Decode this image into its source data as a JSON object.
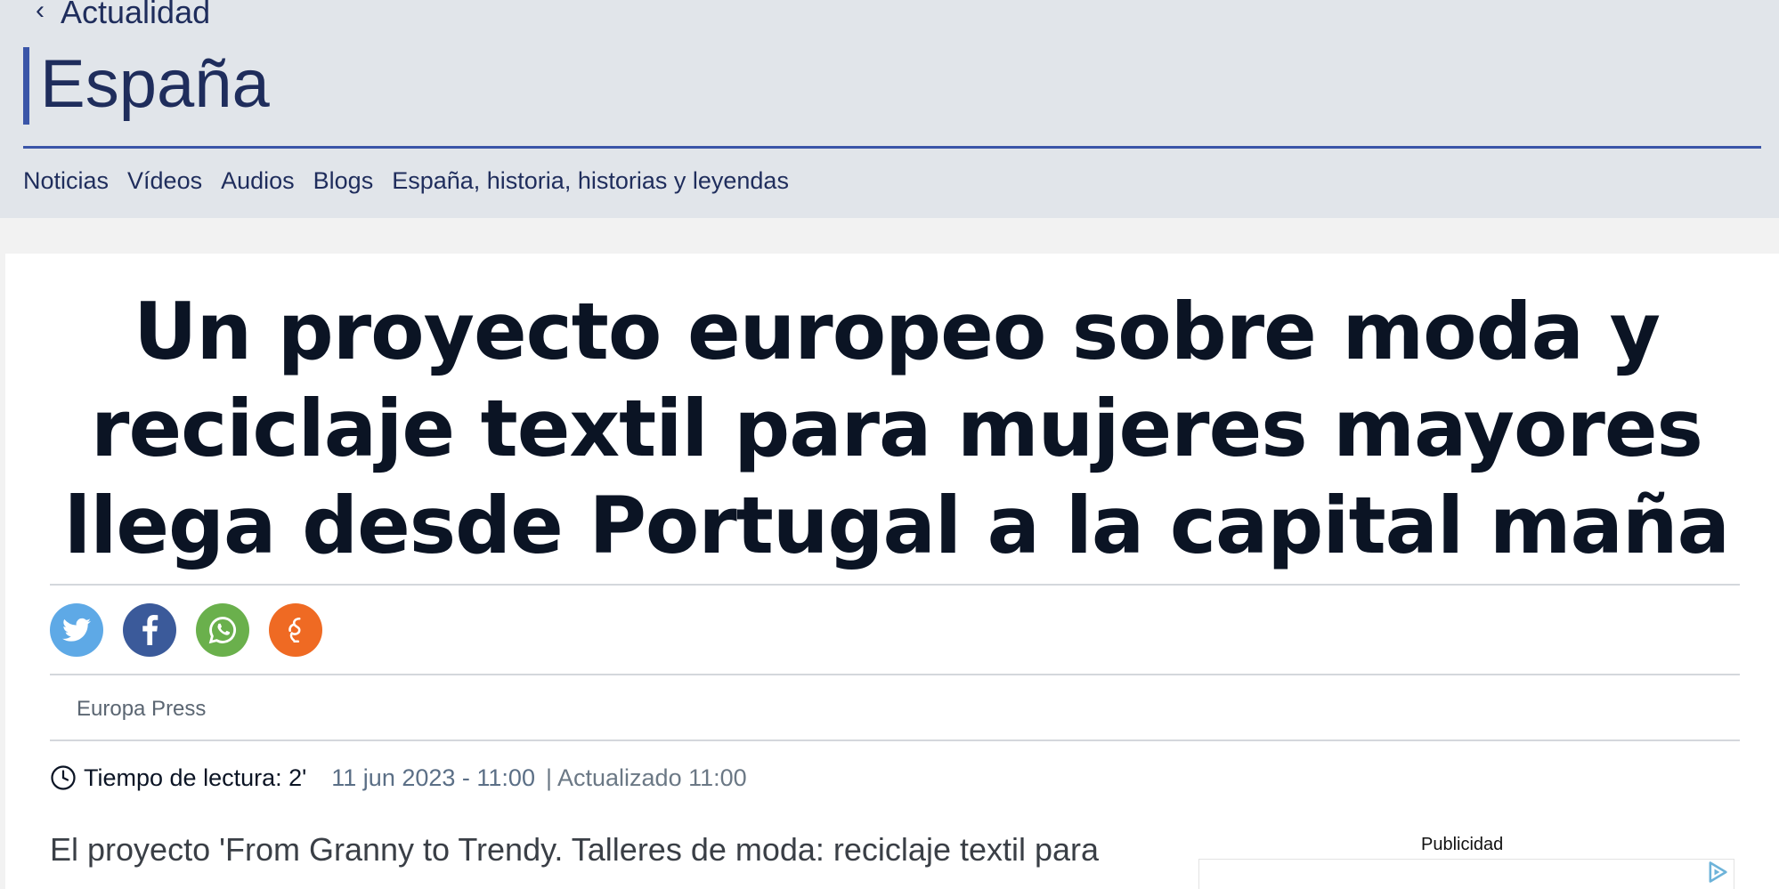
{
  "header": {
    "back_label": "Actualidad",
    "section_title": "España",
    "nav": [
      "Noticias",
      "Vídeos",
      "Audios",
      "Blogs",
      "España, historia, historias y leyendas"
    ],
    "accent_color": "#3a55a8"
  },
  "article": {
    "headline": "Un proyecto europeo sobre moda y reciclaje textil para mujeres mayores llega desde Portugal a la capital maña",
    "share_icons": [
      "twitter-icon",
      "facebook-icon",
      "whatsapp-icon",
      "meneame-icon"
    ],
    "source": "Europa Press",
    "reading_time": "Tiempo de lectura: 2'",
    "date": "11 jun 2023 - 11:00",
    "updated": "| Actualizado 11:00",
    "lead": "El proyecto 'From Granny to Trendy. Talleres de moda: reciclaje textil para"
  },
  "ad": {
    "label": "Publicidad"
  }
}
